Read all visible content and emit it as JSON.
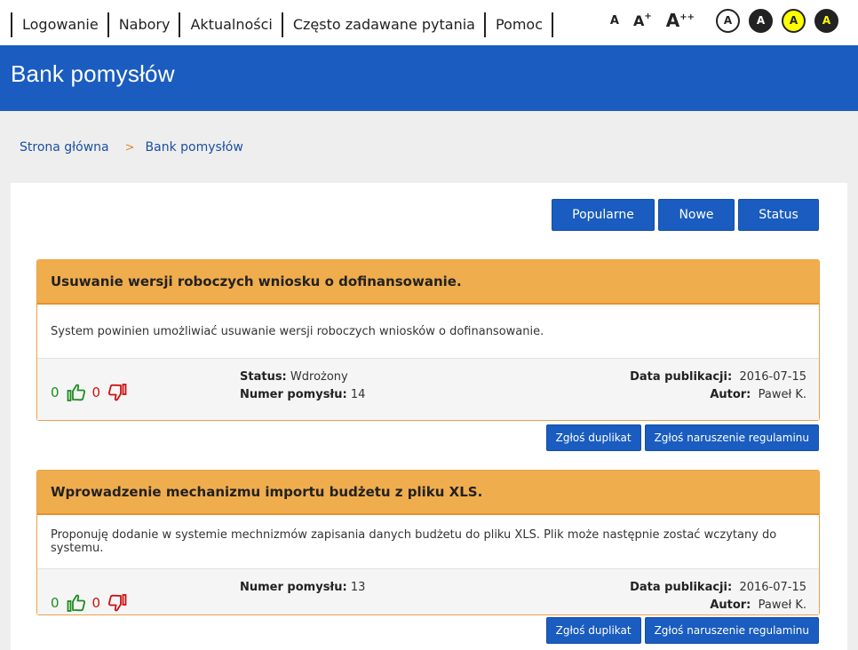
{
  "nav": {
    "items": [
      "Logowanie",
      "Nabory",
      "Aktualności",
      "Często zadawane pytania",
      "Pomoc"
    ]
  },
  "accessibility": {
    "font_small": "A",
    "font_medium": "A",
    "font_medium_sup": "+",
    "font_large": "A",
    "font_large_sup": "++",
    "contrast_labels": [
      "A",
      "A",
      "A",
      "A"
    ]
  },
  "banner": {
    "title": "Bank pomysłów"
  },
  "breadcrumb": {
    "home": "Strona główna",
    "separator": ">",
    "current": "Bank pomysłów"
  },
  "filters": {
    "popular": "Popularne",
    "new": "Nowe",
    "status": "Status"
  },
  "labels": {
    "status": "Status:",
    "idea_number": "Numer pomysłu:",
    "published": "Data publikacji:",
    "author": "Autor:",
    "report_duplicate": "Zgłoś duplikat",
    "report_violation": "Zgłoś naruszenie regulaminu"
  },
  "ideas": [
    {
      "title": "Usuwanie wersji roboczych wniosku o dofinansowanie.",
      "description": "System powinien umożliwiać usuwanie wersji roboczych wniosków o dofinansowanie.",
      "likes": "0",
      "dislikes": "0",
      "status": "Wdrożony",
      "number": "14",
      "date": "2016-07-15",
      "author": "Paweł K."
    },
    {
      "title": "Wprowadzenie mechanizmu importu budżetu z pliku XLS.",
      "description": "Proponuję dodanie w systemie mechnizmów zapisania danych budżetu do pliku XLS. Plik może następnie zostać wczytany do systemu.",
      "likes": "0",
      "dislikes": "0",
      "number": "13",
      "date": "2016-07-15",
      "author": "Paweł K."
    }
  ],
  "colors": {
    "brand_blue": "#1a5cbf",
    "card_header": "#f0ad4e",
    "like_green": "#1e8c1e",
    "dislike_red": "#cc1111"
  }
}
